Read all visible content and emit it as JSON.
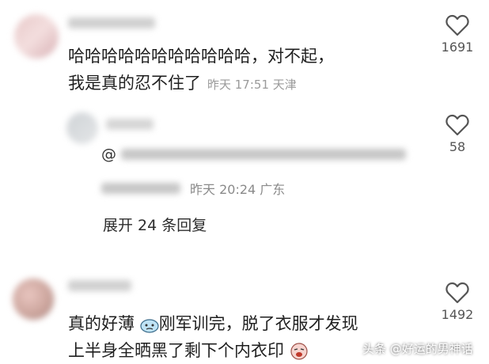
{
  "comments": [
    {
      "text_line1": "哈哈哈哈哈哈哈哈哈哈哈，对不起，",
      "text_line2": "我是真的忍不住了",
      "meta": "昨天 17:51 天津",
      "likes": "1691"
    },
    {
      "reply_prefix": "@",
      "meta": "昨天 20:24 广东",
      "likes": "58",
      "expand_label": "展开 24 条回复"
    },
    {
      "text_line1_a": "真的好薄",
      "text_line1_b": "刚军训完，脱了衣服才发现",
      "text_line2": "上半身全晒黑了剩下个内衣印",
      "likes": "1492"
    }
  ],
  "watermark": "头条 @好运的男神话",
  "icons": {
    "like": "heart-outline-icon",
    "emoji1": "sweat-emoji-icon",
    "emoji2": "crying-emoji-icon"
  }
}
